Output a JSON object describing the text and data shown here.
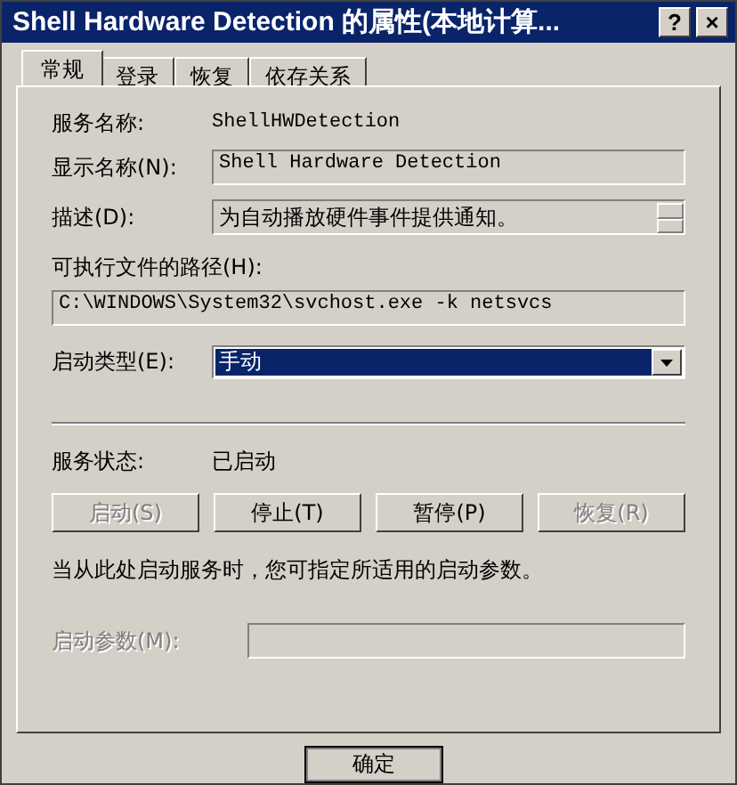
{
  "window": {
    "title": "Shell Hardware Detection 的属性(本地计算...",
    "help": "?",
    "close": "×"
  },
  "tabs": [
    {
      "label": "常规",
      "selected": true
    },
    {
      "label": "登录",
      "selected": false
    },
    {
      "label": "恢复",
      "selected": false
    },
    {
      "label": "依存关系",
      "selected": false
    }
  ],
  "service_name": {
    "label": "服务名称:",
    "value": "ShellHWDetection"
  },
  "display_name": {
    "label": "显示名称(N):",
    "value": "Shell Hardware Detection"
  },
  "description": {
    "label": "描述(D):",
    "value": "为自动播放硬件事件提供通知。"
  },
  "executable_path": {
    "label": "可执行文件的路径(H):",
    "value": "C:\\WINDOWS\\System32\\svchost.exe -k netsvcs"
  },
  "startup_type": {
    "label": "启动类型(E):",
    "value": "手动"
  },
  "service_status": {
    "label": "服务状态:",
    "value": "已启动"
  },
  "service_buttons": [
    {
      "label": "启动(S)",
      "disabled": true
    },
    {
      "label": "停止(T)",
      "disabled": false
    },
    {
      "label": "暂停(P)",
      "disabled": false
    },
    {
      "label": "恢复(R)",
      "disabled": true
    }
  ],
  "hint": "当从此处启动服务时，您可指定所适用的启动参数。",
  "start_parameters": {
    "label": "启动参数(M):",
    "disabled": true
  },
  "buttons": [
    {
      "label": "确定"
    }
  ]
}
